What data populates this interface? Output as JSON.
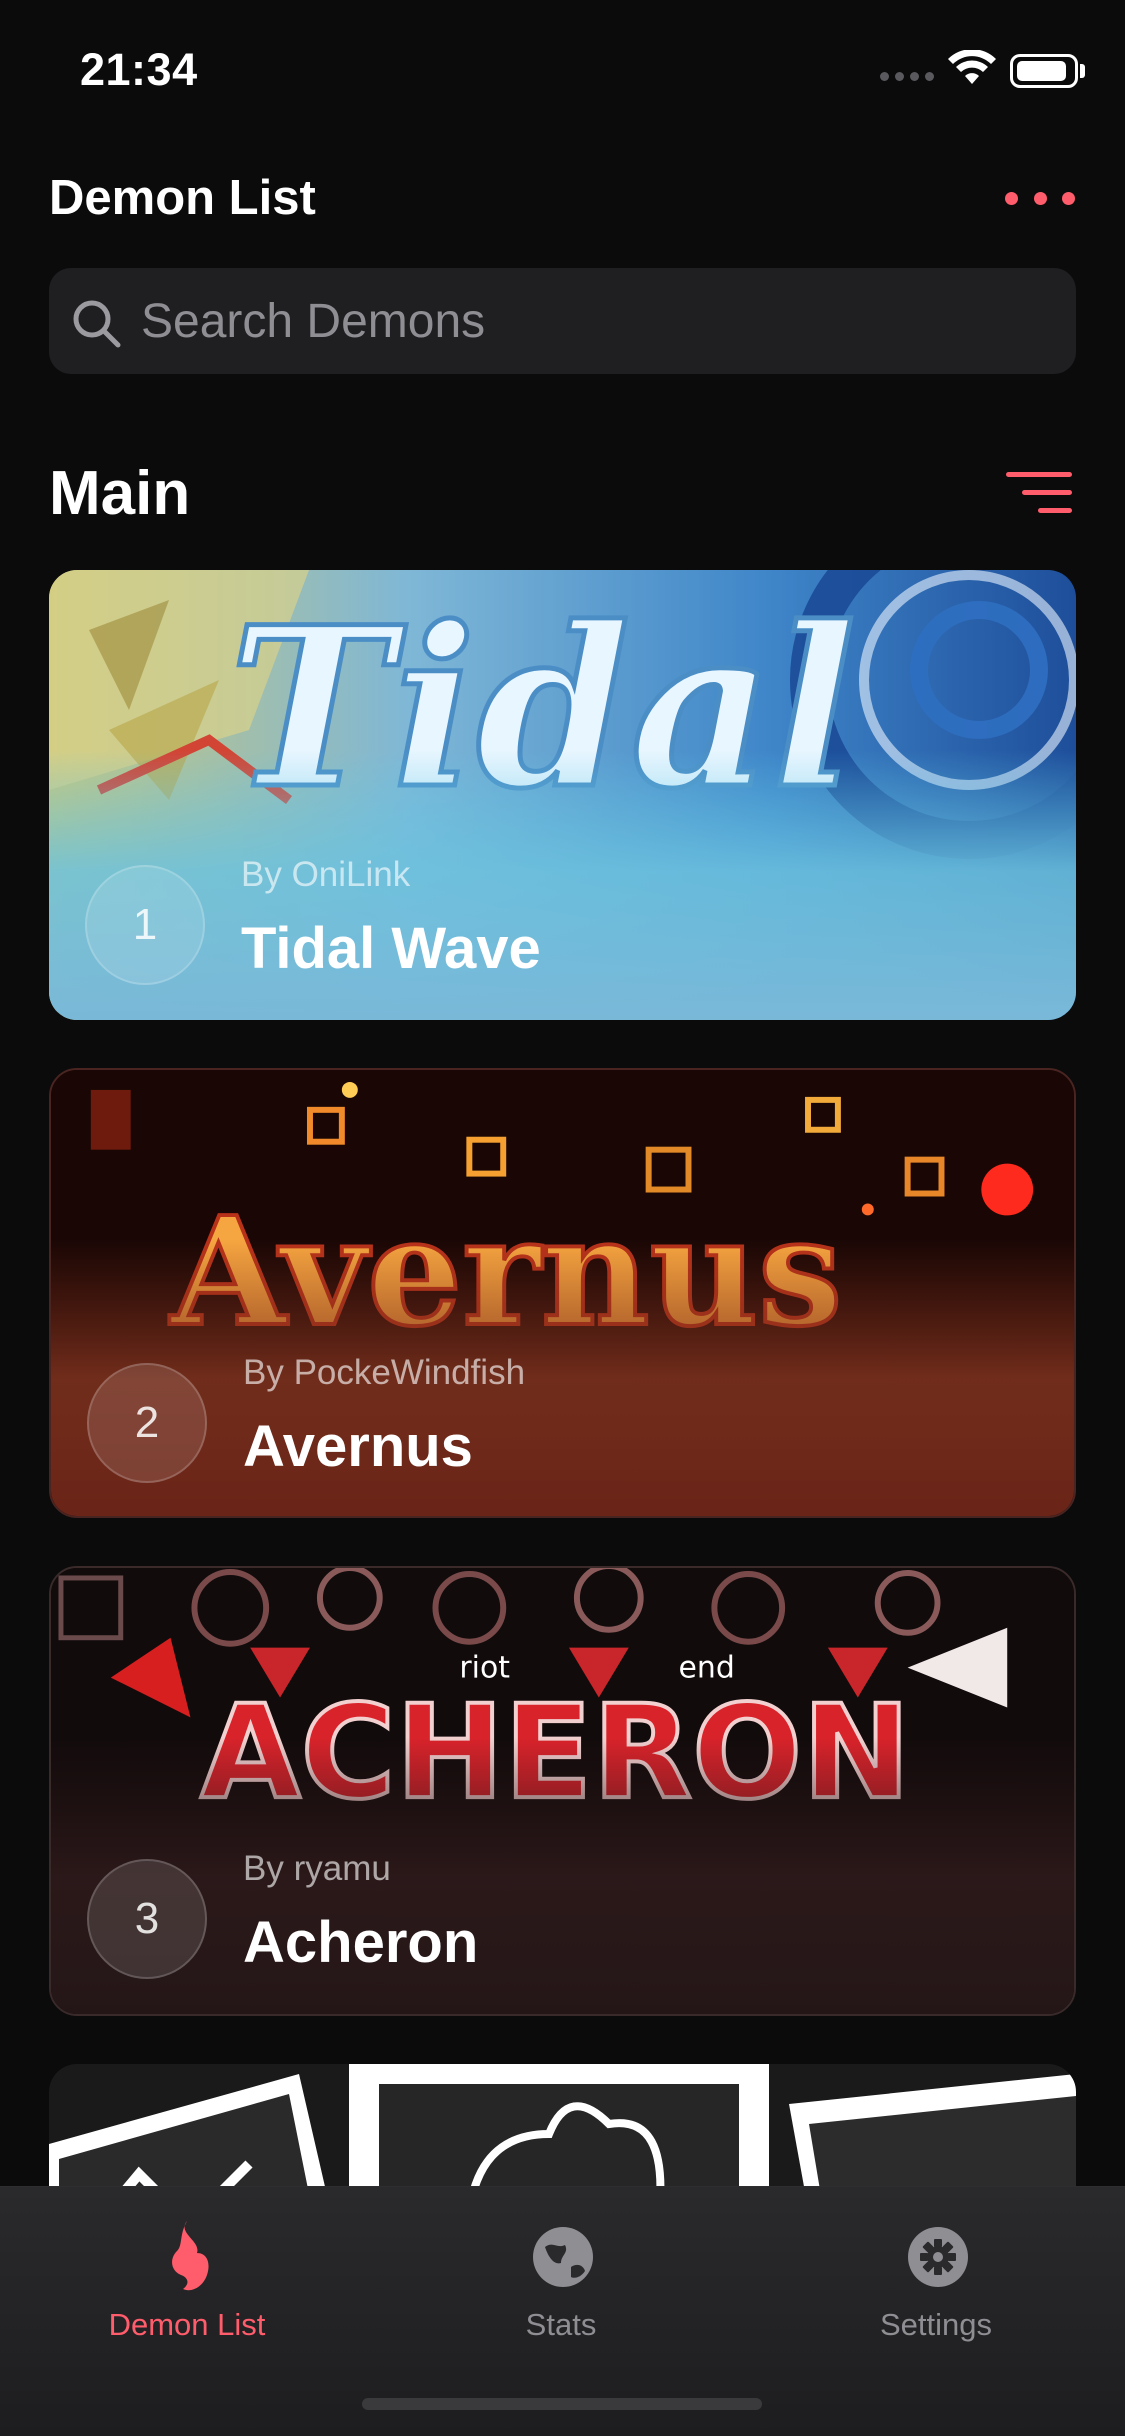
{
  "status_bar": {
    "time": "21:34",
    "battery_level": 0.9
  },
  "header": {
    "title": "Demon List",
    "more_icon": "ellipsis-icon"
  },
  "search": {
    "placeholder": "Search Demons",
    "value": ""
  },
  "section": {
    "title": "Main",
    "filter_icon": "filter-lines-icon"
  },
  "demons": [
    {
      "rank": "1",
      "author": "By OniLink",
      "name": "Tidal Wave",
      "art_text": "Tidal"
    },
    {
      "rank": "2",
      "author": "By PockeWindfish",
      "name": "Avernus",
      "art_text": "Avernus"
    },
    {
      "rank": "3",
      "author": "By ryamu",
      "name": "Acheron",
      "art_text": "ACHERON",
      "art_subtext": [
        "riot",
        "end"
      ]
    }
  ],
  "tabs": [
    {
      "label": "Demon List",
      "icon": "flame-icon",
      "active": true
    },
    {
      "label": "Stats",
      "icon": "globe-icon",
      "active": false
    },
    {
      "label": "Settings",
      "icon": "gear-icon",
      "active": false
    }
  ],
  "colors": {
    "accent": "#ff5c6c",
    "background": "#0b0b0c",
    "inactive_tab": "#8e8e93"
  }
}
